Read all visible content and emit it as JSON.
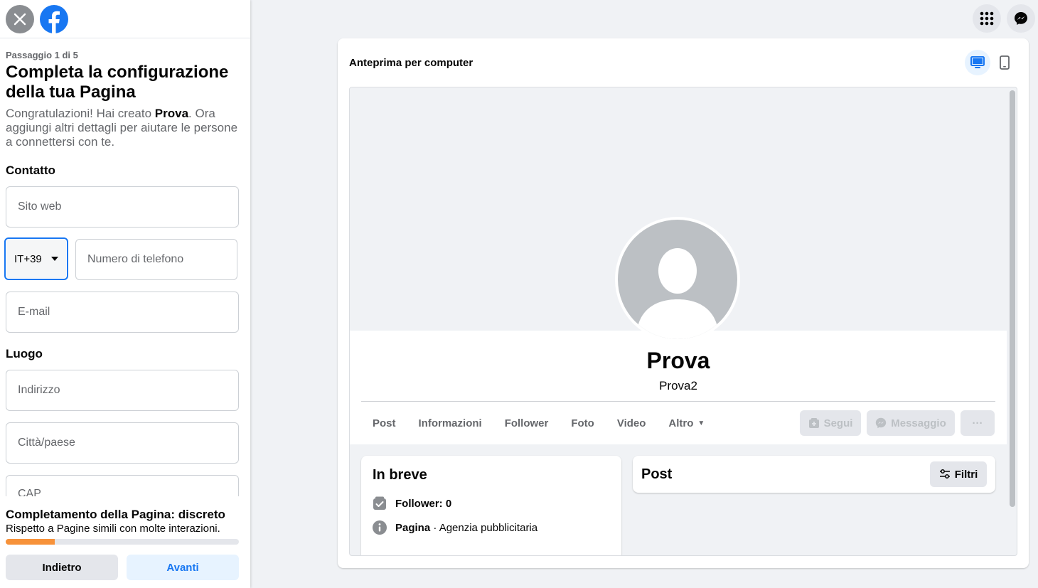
{
  "sidebar": {
    "step": "Passaggio 1 di 5",
    "title": "Completa la configurazione della tua Pagina",
    "desc_prefix": "Congratulazioni! Hai creato ",
    "desc_name": "Prova",
    "desc_suffix": ". Ora aggiungi altri dettagli per aiutare le persone a connettersi con te.",
    "contact_heading": "Contatto",
    "website_placeholder": "Sito web",
    "country_code": "IT+39",
    "phone_placeholder": "Numero di telefono",
    "email_placeholder": "E-mail",
    "location_heading": "Luogo",
    "address_placeholder": "Indirizzo",
    "city_placeholder": "Città/paese",
    "zip_placeholder": "CAP"
  },
  "footer": {
    "completion": "Completamento della Pagina: discreto",
    "completion_sub": "Rispetto a Pagine simili con molte interazioni.",
    "progress_percent": 21,
    "progress_color": "#f7923a",
    "back_label": "Indietro",
    "next_label": "Avanti"
  },
  "preview": {
    "title": "Anteprima per computer",
    "page_name": "Prova",
    "page_username": "Prova2",
    "tabs": [
      "Post",
      "Informazioni",
      "Follower",
      "Foto",
      "Video",
      "Altro"
    ],
    "follow_label": "Segui",
    "message_label": "Messaggio",
    "more_label": "···",
    "brief_title": "In breve",
    "followers_text": "Follower: 0",
    "category_bold": "Pagina",
    "category_rest": " · Agenzia pubblicitaria",
    "posts_title": "Post",
    "filter_label": "Filtri"
  },
  "colors": {
    "brand": "#1877f2",
    "progress": "#f7923a"
  },
  "icons": [
    "close-icon",
    "facebook-logo-icon",
    "apps-grid-icon",
    "messenger-icon",
    "desktop-icon",
    "mobile-icon",
    "caret-down-icon",
    "follow-icon",
    "messenger-small-icon",
    "follower-check-icon",
    "info-icon",
    "filter-icon"
  ]
}
